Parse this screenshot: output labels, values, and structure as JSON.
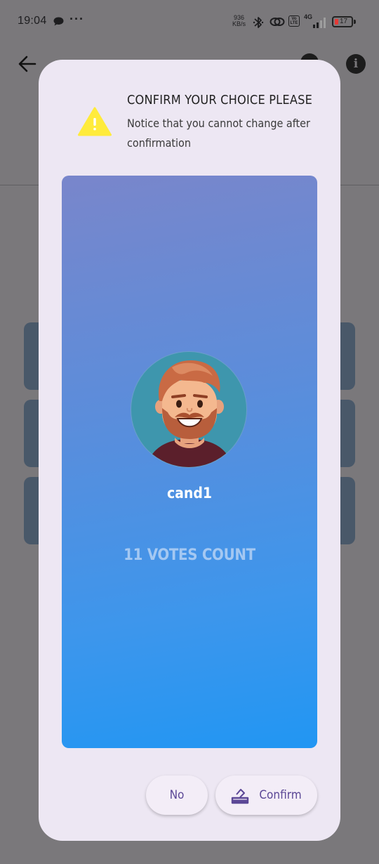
{
  "status_bar": {
    "time": "19:04",
    "speed_value": "936",
    "speed_unit": "KB/s",
    "network": "4G",
    "volte": "Vo LTE",
    "battery": "17"
  },
  "dialog": {
    "title": "CONFIRM YOUR CHOICE PLEASE",
    "message": "Notice that you cannot change after confirmation",
    "candidate": {
      "name": "cand1",
      "votes": "11 VOTES COUNT"
    },
    "buttons": {
      "no": "No",
      "confirm": "Confirm"
    }
  },
  "colors": {
    "scrim": "#7a787b",
    "dialog_bg": "#ede7f3",
    "card_gradient_start": "#7986cb",
    "card_gradient_end": "#2196f3",
    "accent": "#5b4796",
    "warning": "#ffeb3b"
  },
  "icons": [
    "chat-icon",
    "bluetooth-icon",
    "link-icon",
    "signal-icon",
    "battery-icon",
    "back-arrow-icon",
    "info-icon",
    "warning-icon",
    "avatar-image",
    "ballot-icon"
  ]
}
